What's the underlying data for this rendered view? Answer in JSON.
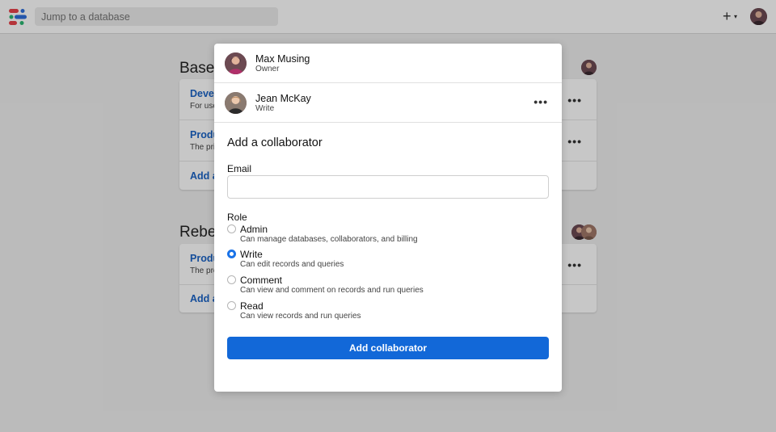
{
  "topbar": {
    "search_placeholder": "Jump to a database",
    "plus_icon": "+",
    "chevron_icon": "▾"
  },
  "background": {
    "sections": [
      {
        "title": "BaseD",
        "rows": [
          {
            "title": "Develo",
            "sub": "For use"
          },
          {
            "title": "Produ",
            "sub": "The pri"
          }
        ],
        "add_label": "Add a"
      },
      {
        "title": "Rebel-",
        "rows": [
          {
            "title": "Produ",
            "sub": "The pro"
          }
        ],
        "add_label": "Add a"
      }
    ],
    "menu_icon": "•••"
  },
  "modal": {
    "collaborators": [
      {
        "name": "Max Musing",
        "role": "Owner"
      },
      {
        "name": "Jean McKay",
        "role": "Write"
      }
    ],
    "menu_icon": "•••",
    "heading": "Add a collaborator",
    "email_label": "Email",
    "email_value": "",
    "role_label": "Role",
    "roles": [
      {
        "title": "Admin",
        "desc": "Can manage databases, collaborators, and billing",
        "checked": false
      },
      {
        "title": "Write",
        "desc": "Can edit records and queries",
        "checked": true
      },
      {
        "title": "Comment",
        "desc": "Can view and comment on records and run queries",
        "checked": false
      },
      {
        "title": "Read",
        "desc": "Can view records and run queries",
        "checked": false
      }
    ],
    "submit_label": "Add collaborator"
  },
  "colors": {
    "accent": "#1268d8",
    "link": "#1a63c6",
    "logo_red": "#e8434b",
    "logo_green": "#2bb673",
    "logo_blue": "#2f6fdb"
  }
}
